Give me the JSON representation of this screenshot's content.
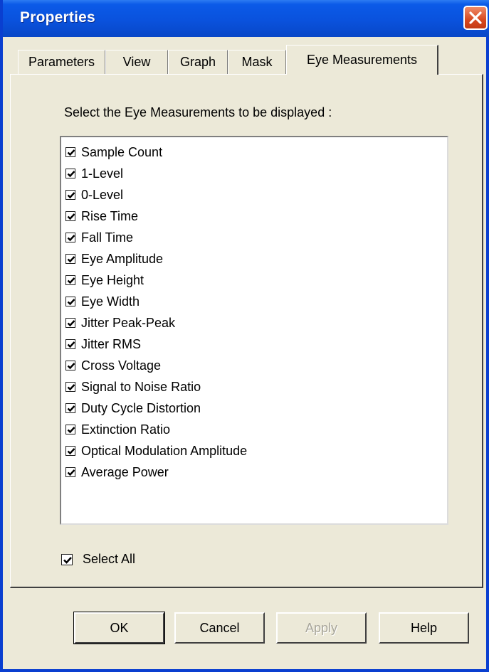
{
  "window": {
    "title": "Properties"
  },
  "tabs": [
    {
      "label": "Parameters"
    },
    {
      "label": "View"
    },
    {
      "label": "Graph"
    },
    {
      "label": "Mask"
    },
    {
      "label": "Eye Measurements",
      "active": true
    }
  ],
  "panel": {
    "prompt": "Select the Eye Measurements to be displayed :",
    "items": [
      {
        "label": "Sample Count",
        "checked": true
      },
      {
        "label": "1-Level",
        "checked": true
      },
      {
        "label": "0-Level",
        "checked": true
      },
      {
        "label": "Rise Time",
        "checked": true
      },
      {
        "label": "Fall Time",
        "checked": true
      },
      {
        "label": "Eye Amplitude",
        "checked": true
      },
      {
        "label": "Eye Height",
        "checked": true
      },
      {
        "label": "Eye Width",
        "checked": true
      },
      {
        "label": "Jitter Peak-Peak",
        "checked": true
      },
      {
        "label": "Jitter RMS",
        "checked": true
      },
      {
        "label": "Cross Voltage",
        "checked": true
      },
      {
        "label": "Signal to Noise Ratio",
        "checked": true
      },
      {
        "label": "Duty Cycle Distortion",
        "checked": true
      },
      {
        "label": "Extinction Ratio",
        "checked": true
      },
      {
        "label": "Optical Modulation Amplitude",
        "checked": true
      },
      {
        "label": "Average Power",
        "checked": true
      }
    ],
    "select_all": {
      "label": "Select All",
      "checked": true
    }
  },
  "buttons": {
    "ok": "OK",
    "cancel": "Cancel",
    "apply": "Apply",
    "help": "Help"
  }
}
